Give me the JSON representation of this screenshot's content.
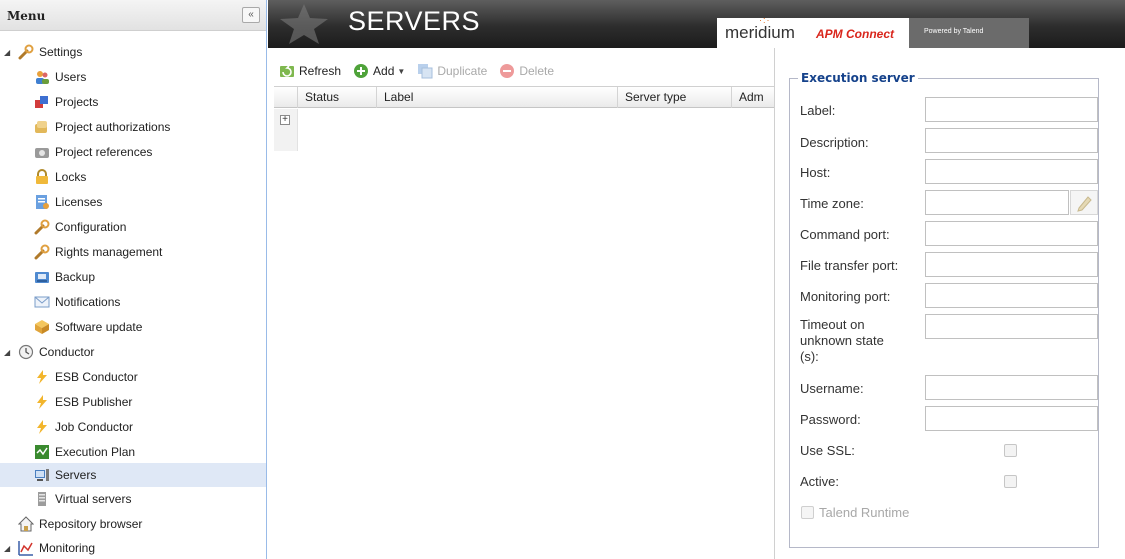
{
  "sidebar": {
    "title": "Menu",
    "collapse_label": "«",
    "items": [
      {
        "label": "Settings"
      },
      {
        "label": "Users"
      },
      {
        "label": "Projects"
      },
      {
        "label": "Project authorizations"
      },
      {
        "label": "Project references"
      },
      {
        "label": "Locks"
      },
      {
        "label": "Licenses"
      },
      {
        "label": "Configuration"
      },
      {
        "label": "Rights management"
      },
      {
        "label": "Backup"
      },
      {
        "label": "Notifications"
      },
      {
        "label": "Software update"
      },
      {
        "label": "Conductor"
      },
      {
        "label": "ESB Conductor"
      },
      {
        "label": "ESB Publisher"
      },
      {
        "label": "Job Conductor"
      },
      {
        "label": "Execution Plan"
      },
      {
        "label": "Servers"
      },
      {
        "label": "Virtual servers"
      },
      {
        "label": "Repository browser"
      },
      {
        "label": "Monitoring"
      }
    ]
  },
  "banner": {
    "title": "SERVERS",
    "brand_meridium": "meridium",
    "brand_apm": "APM Connect",
    "powered_by": "Powered by Talend"
  },
  "toolbar": {
    "refresh": "Refresh",
    "add": "Add",
    "duplicate": "Duplicate",
    "delete": "Delete"
  },
  "grid": {
    "columns": [
      "Status",
      "Label",
      "Server type",
      "Adm"
    ],
    "expander": "+"
  },
  "form": {
    "legend": "Execution server",
    "fields": {
      "label": {
        "label": "Label:",
        "value": ""
      },
      "description": {
        "label": "Description:",
        "value": ""
      },
      "host": {
        "label": "Host:",
        "value": ""
      },
      "timezone": {
        "label": "Time zone:",
        "value": ""
      },
      "command_port": {
        "label": "Command port:",
        "value": ""
      },
      "file_transfer_port": {
        "label": "File transfer port:",
        "value": ""
      },
      "monitoring_port": {
        "label": "Monitoring port:",
        "value": ""
      },
      "timeout_line1": "Timeout on",
      "timeout_line2": "unknown state",
      "timeout_line3": "(s):",
      "timeout": {
        "value": ""
      },
      "username": {
        "label": "Username:",
        "value": ""
      },
      "password": {
        "label": "Password:",
        "value": ""
      },
      "use_ssl": {
        "label": "Use SSL:",
        "checked": false
      },
      "active": {
        "label": "Active:",
        "checked": false
      }
    },
    "talend_runtime": {
      "label": "Talend Runtime",
      "checked": false,
      "disabled": true
    }
  },
  "colors": {
    "selected_row": "#dfe8f6",
    "legend_text": "#15428b",
    "banner_dark": "#2d2d2d",
    "brand_red": "#d9261c"
  }
}
